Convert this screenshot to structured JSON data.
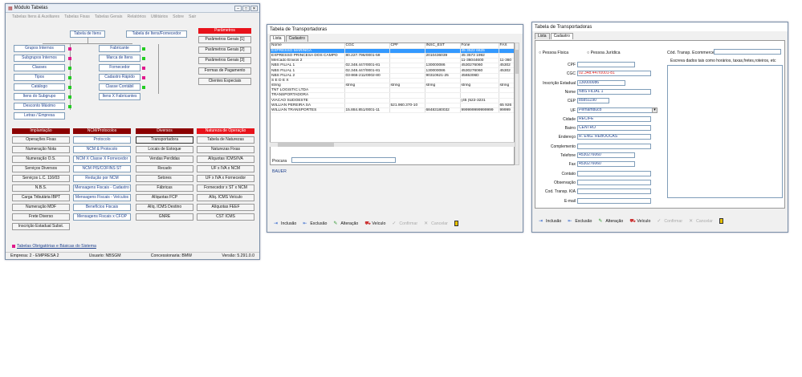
{
  "win1": {
    "title": "Módulo Tabelas",
    "menu": [
      "Tabelas Itens & Auxiliares",
      "Tabelas Fixas",
      "Tabelas Gerais",
      "Relatórios",
      "Utilitários",
      "Sobre",
      "Sair"
    ],
    "tree": {
      "tab_itens": "Tabela de Itens",
      "tab_itens_forn": "Tabela de Itens/Fornecedor",
      "left": [
        "Grupos Internos",
        "Subgrupos Internos",
        "Classes",
        "Tipos",
        "Catálogo",
        "Itens do Subgrupo",
        "Desconto Máximo",
        "Letras / Empresa"
      ],
      "mid": [
        "Fabricante",
        "Marca de Itens",
        "Fornecedor",
        "Cadastro Rápido",
        "Classe Contábil",
        "Itens X Fabricantes"
      ]
    },
    "params": {
      "header": "Parâmetros",
      "items": [
        "Parâmetros Gerais [1]",
        "Parâmetros Gerais [2]",
        "Parâmetros Gerais [3]",
        "Formas de Pagamento",
        "Clientes Especiais"
      ]
    },
    "groups": [
      {
        "header": "Implantação",
        "items": [
          "Operações Fixas",
          "Numeração Nota",
          "Numeração O.S.",
          "Serviços Diversos",
          "Serviços L.C. 116/03",
          "N.B.S.",
          "Carga Tributária IBPT",
          "Numeração MDF",
          "Frete Diverso",
          "Inscrição Estadual Subst."
        ]
      },
      {
        "header": "NCM/Protocolos",
        "items": [
          "Protocolo",
          "NCM & Protocolo",
          "NCM X Classe X Fornecedor",
          "NCM PIS/COFINS ST",
          "Redução por NCM",
          "Mensagens Fiscais - Cadastro",
          "Mensagens Fiscais - Veículos",
          "Benefícios Fiscais",
          "Mensagens Fiscais x CFOP"
        ]
      },
      {
        "header": "Diversos",
        "items": [
          "Transportadora",
          "Locais de Estoque",
          "Vendas Perdidas",
          "Recado",
          "Setores",
          "Fábricas",
          "Alíquotas FCP",
          "Alíq. ICMS Destino",
          "GNRE"
        ]
      },
      {
        "header": "Natureza de Operação",
        "items": [
          "Tabela de Naturezas",
          "Naturezas Fixas",
          "Alíquotas ICMS/IVA",
          "UF x IVA x NCM",
          "UF x IVA x Fornecedor",
          "Fornecedor x ST x NCM",
          "Alíq. ICMS Veículo",
          "Alíquotas FEEF",
          "CST ICMS"
        ]
      }
    ],
    "footer_link": "Tabelas Obrigatórias e Básicas do Sistema",
    "status": {
      "empresa": "Empresa: 2 - EMPRESA 2",
      "usuario": "Usuario: NBSGM",
      "concessionaria": "Concessionaria: BMW",
      "versao": "Versão: 5.291.0.0"
    }
  },
  "win2": {
    "title": "Tabela de Transportadoras",
    "tabs": [
      "Lista",
      "Cadastro"
    ],
    "columns": [
      "Nome",
      "CGC",
      "CPF",
      "INSC_EST",
      "Fone",
      "FAX"
    ],
    "rows": [
      [
        "EXPRESSO MARINGÁ",
        "",
        "",
        "",
        "45 3522 6625",
        ""
      ],
      [
        "EXPRESSO PRINCESA DOS CAMPO",
        "80.227.796/0001-59",
        "",
        "2010436039",
        "45 3573 1992",
        ""
      ],
      [
        "Mercado Envios 2",
        "",
        "",
        "",
        "11-36044600",
        "11-360"
      ],
      [
        "NBS FILIAL 1",
        "02.348.447/0001-81",
        "",
        "130000086",
        "4530276060",
        "45302"
      ],
      [
        "NBS FILIAL 1",
        "02.348.447/0001-81",
        "",
        "130000086",
        "4530276060",
        "45302"
      ],
      [
        "NBS FILIAL 2",
        "03-866-211/0002-80",
        "",
        "90310621-25",
        "4565306D",
        ""
      ],
      [
        "S E D E X",
        "",
        "",
        "",
        "",
        ""
      ],
      [
        "string",
        "string",
        "string",
        "string",
        "string",
        "string"
      ],
      [
        "TNT LOGISTIC LTDA",
        "",
        "",
        "",
        "",
        ""
      ],
      [
        "TRANSPORTADORA",
        "",
        "",
        "",
        "",
        ""
      ],
      [
        "VIACAO SUDOESTE",
        "",
        "",
        "",
        "(45 )522-3231",
        ""
      ],
      [
        "WILLIAN PEREIRA SA",
        "",
        "521.960.370-10",
        "",
        "",
        "65 926"
      ],
      [
        "WILLIAN TRANSPORTES",
        "15.884.851/0001-11",
        "",
        "68483180032",
        "999999999999999",
        "99999"
      ]
    ],
    "search_label": "Procura",
    "search_value": "",
    "found": "BAUER",
    "toolbar": [
      "Inclusão",
      "Exclusão",
      "Alteração",
      "Veículo",
      "Confirmar",
      "Cancelar"
    ]
  },
  "win3": {
    "title": "Tabela de Transportadoras",
    "tabs": [
      "Lista",
      "Cadastro"
    ],
    "pf": "Pessoa Física",
    "pj": "Pessoa Jurídica",
    "ecommerce_label": "Cód. Transp. Ecommerce",
    "notes_label": "Escreva dados tais como horários, taxas,fretes,roteiros, etc",
    "fields": [
      {
        "label": "CPF",
        "value": ""
      },
      {
        "label": "CGC",
        "value": "02.348.447/0001-81"
      },
      {
        "label": "Inscrição Estadual",
        "value": "130000086"
      },
      {
        "label": "Nome",
        "value": "NBS FILIAL 1"
      },
      {
        "label": "CEP",
        "value": "85851190"
      },
      {
        "label": "UF",
        "value": "Pernambuco"
      },
      {
        "label": "Cidade",
        "value": "RECIFE"
      },
      {
        "label": "Bairro",
        "value": "CENTRO"
      },
      {
        "label": "Endereço",
        "value": "R. ENG. REBOUCAS"
      },
      {
        "label": "Complemento",
        "value": ""
      },
      {
        "label": "Telefone",
        "value": "4530276060"
      },
      {
        "label": "Fax",
        "value": "4530276060"
      },
      {
        "label": "Contato",
        "value": ""
      },
      {
        "label": "Observação",
        "value": ""
      },
      {
        "label": "Cod. Transp. KIA",
        "value": ""
      },
      {
        "label": "E-mail",
        "value": ""
      }
    ],
    "toolbar": [
      "Inclusão",
      "Exclusão",
      "Alteração",
      "Veículo",
      "Confirmar",
      "Cancelar"
    ]
  }
}
